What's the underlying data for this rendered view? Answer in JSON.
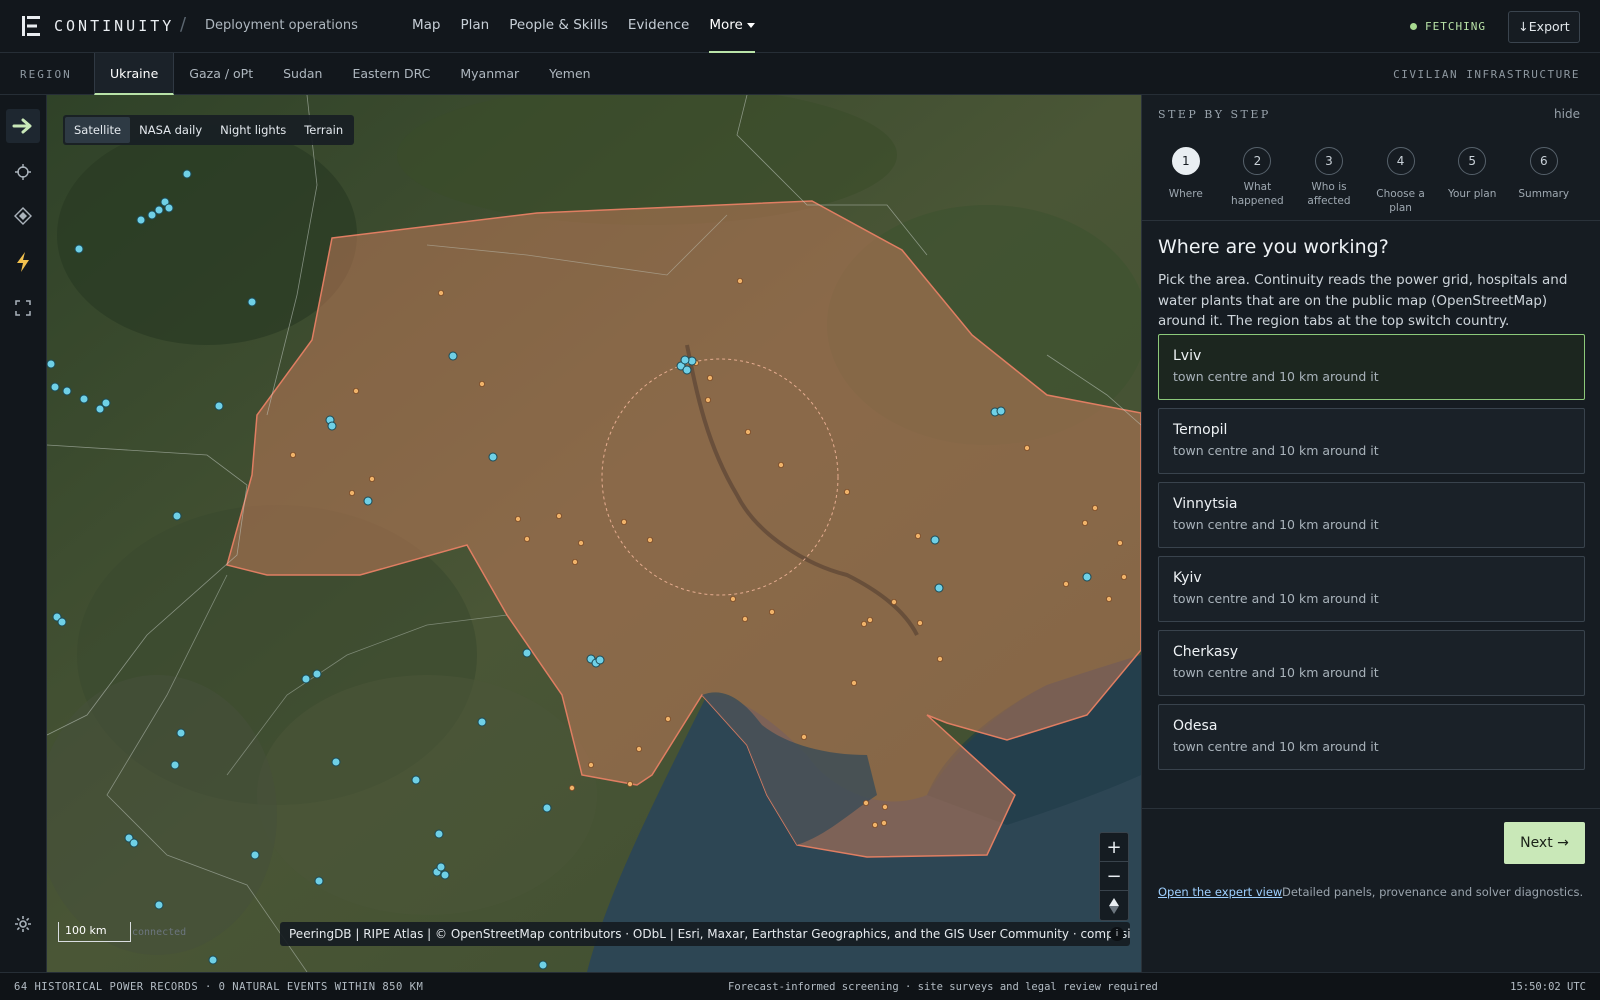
{
  "header": {
    "brand": "CONTINUITY",
    "separator": "/",
    "breadcrumb": "Deployment operations",
    "nav": [
      {
        "label": "Map"
      },
      {
        "label": "Plan"
      },
      {
        "label": "People & Skills"
      },
      {
        "label": "Evidence"
      },
      {
        "label": "More"
      }
    ],
    "status": "FETCHING",
    "export_label": "↓Export"
  },
  "region_bar": {
    "label": "REGION",
    "tabs": [
      "Ukraine",
      "Gaza / oPt",
      "Sudan",
      "Eastern DRC",
      "Myanmar",
      "Yemen"
    ],
    "active_tab": "Ukraine",
    "layer": "CIVILIAN INFRASTRUCTURE"
  },
  "map": {
    "basemaps": [
      "Satellite",
      "NASA daily",
      "Night lights",
      "Terrain"
    ],
    "active_basemap": "Satellite",
    "zoom_in": "+",
    "zoom_out": "−",
    "scale": "100 km",
    "connection": "connected",
    "attribution": "PeeringDB | RIPE Atlas | © OpenStreetMap contributors · ODbL | Esri, Maxar, Earthstar Geographics, and the GIS User Community · composite imagery",
    "info": "i"
  },
  "panel": {
    "header": "STEP BY STEP",
    "hide": "hide",
    "steps": [
      {
        "num": "1",
        "label": "Where"
      },
      {
        "num": "2",
        "label": "What happened"
      },
      {
        "num": "3",
        "label": "Who is affected"
      },
      {
        "num": "4",
        "label": "Choose a plan"
      },
      {
        "num": "5",
        "label": "Your plan"
      },
      {
        "num": "6",
        "label": "Summary"
      }
    ],
    "active_step": 1,
    "title": "Where are you working?",
    "description": "Pick the area. Continuity reads the power grid, hospitals and water plants that are on the public map (OpenStreetMap) around it. The region tabs at the top switch country.",
    "areas": [
      {
        "name": "Lviv",
        "sub": "town centre and 10 km around it"
      },
      {
        "name": "Ternopil",
        "sub": "town centre and 10 km around it"
      },
      {
        "name": "Vinnytsia",
        "sub": "town centre and 10 km around it"
      },
      {
        "name": "Kyiv",
        "sub": "town centre and 10 km around it"
      },
      {
        "name": "Cherkasy",
        "sub": "town centre and 10 km around it"
      },
      {
        "name": "Odesa",
        "sub": "town centre and 10 km around it"
      }
    ],
    "selected_area": "Lviv",
    "next_label": "Next →",
    "expert_link": "Open the expert view",
    "expert_note": "Detailed panels, provenance and solver diagnostics."
  },
  "footer": {
    "left": "64 HISTORICAL POWER RECORDS · 0 NATURAL EVENTS WITHIN 850 KM",
    "middle": "Forecast-informed screening · site surveys and legal review required",
    "time": "15:50:02 UTC"
  },
  "colors": {
    "accent": "#b9e3a8",
    "selected_border": "#8cc97a",
    "aoi_fill": "#c07a5a",
    "infra_marker": "#f0b36a",
    "network_marker": "#6fd0e6",
    "sea": "#2d4654"
  }
}
